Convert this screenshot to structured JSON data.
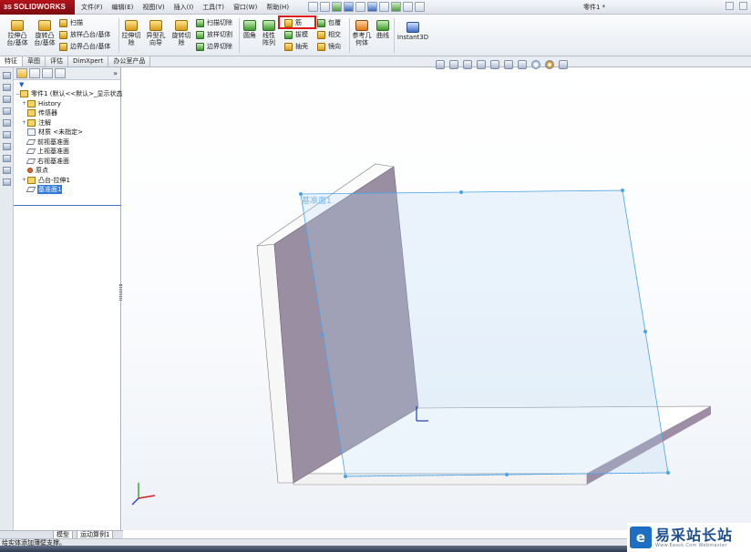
{
  "app": {
    "logo": "SOLIDWORKS",
    "logo_mark": "3S",
    "document_title": "零件1 *"
  },
  "menu": [
    "文件(F)",
    "编辑(E)",
    "视图(V)",
    "插入(I)",
    "工具(T)",
    "窗口(W)",
    "帮助(H)"
  ],
  "toolbar": {
    "extrude_boss": "拉伸凸台/基体",
    "revolve_boss": "旋转凸台/基体",
    "sweep": "扫描",
    "loft_boss": "放样凸台/基体",
    "boundary_boss": "边界凸台/基体",
    "extrude_cut": "拉伸切除",
    "hole_wizard": "异型孔向导",
    "revolve_cut": "旋转切除",
    "swept_cut": "扫描切除",
    "lofted_cut": "放样切割",
    "boundary_cut": "边界切除",
    "fillet": "圆角",
    "linear_pattern": "线性阵列",
    "rib": "筋",
    "draft": "拔模",
    "shell": "抽壳",
    "wrap": "包覆",
    "intersect": "相交",
    "mirror": "镜向",
    "reference_geometry": "参考几何体",
    "curves": "曲线",
    "instant3d": "Instant3D"
  },
  "tabs": [
    "特征",
    "草图",
    "评估",
    "DimXpert",
    "办公室产品"
  ],
  "feature_tree": {
    "more": "»",
    "root": "零件1  (默认<<默认>_显示状态",
    "items": [
      {
        "label": "History",
        "icon": "folder-icon",
        "toggle": "+"
      },
      {
        "label": "传感器",
        "icon": "sensor-icon",
        "toggle": ""
      },
      {
        "label": "注解",
        "icon": "annotation-icon",
        "toggle": "+"
      },
      {
        "label": "材质 <未指定>",
        "icon": "material-icon",
        "toggle": ""
      },
      {
        "label": "前视基准面",
        "icon": "plane-icon",
        "toggle": ""
      },
      {
        "label": "上视基准面",
        "icon": "plane-icon",
        "toggle": ""
      },
      {
        "label": "右视基准面",
        "icon": "plane-icon",
        "toggle": ""
      },
      {
        "label": "原点",
        "icon": "origin-icon",
        "toggle": ""
      },
      {
        "label": "凸台-拉伸1",
        "icon": "extrude-icon",
        "toggle": "+"
      },
      {
        "label": "基准面1",
        "icon": "plane-icon",
        "toggle": "",
        "selected": true
      }
    ]
  },
  "graphics": {
    "plane_label": "基准面1"
  },
  "bottom_tabs": [
    "模型",
    "运动算例1"
  ],
  "status": "给实体添加薄壁支撑。",
  "watermark": {
    "badge": "e",
    "text": "易采站长站",
    "url": "Www.Easck.Com Webmaster"
  }
}
